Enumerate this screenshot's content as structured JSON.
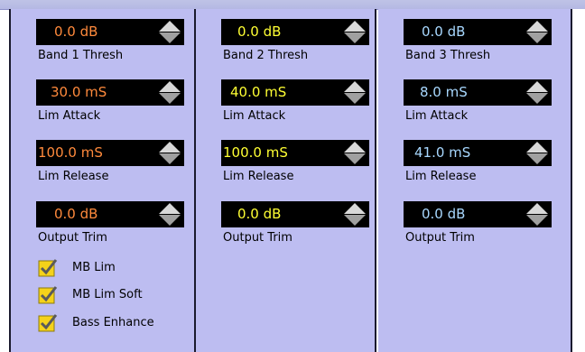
{
  "columns": [
    {
      "thresh": {
        "value": "0.0 dB",
        "label": "Band 1 Thresh"
      },
      "attack": {
        "value": "30.0 mS",
        "label": "Lim Attack"
      },
      "release": {
        "value": "100.0 mS",
        "label": "Lim Release"
      },
      "trim": {
        "value": "0.0 dB",
        "label": "Output Trim"
      },
      "value_color": "#ff8a3c"
    },
    {
      "thresh": {
        "value": "0.0 dB",
        "label": "Band 2 Thresh"
      },
      "attack": {
        "value": "40.0 mS",
        "label": "Lim Attack"
      },
      "release": {
        "value": "100.0 mS",
        "label": "Lim Release"
      },
      "trim": {
        "value": "0.0 dB",
        "label": "Output Trim"
      },
      "value_color": "#ffff33"
    },
    {
      "thresh": {
        "value": "0.0 dB",
        "label": "Band 3 Thresh"
      },
      "attack": {
        "value": "8.0 mS",
        "label": "Lim Attack"
      },
      "release": {
        "value": "41.0 mS",
        "label": "Lim Release"
      },
      "trim": {
        "value": "0.0 dB",
        "label": "Output Trim"
      },
      "value_color": "#a8d8ff"
    }
  ],
  "checkboxes": [
    {
      "label": "MB Lim",
      "checked": true
    },
    {
      "label": "MB Lim Soft",
      "checked": true
    },
    {
      "label": "Bass Enhance",
      "checked": true
    }
  ],
  "colors": {
    "panel_bg": "#bdbdf1",
    "display_bg": "#000000",
    "check_fill": "#f5d21a"
  },
  "icons": {
    "spinner": "up-down-arrow-icon",
    "check": "checkmark-icon"
  }
}
